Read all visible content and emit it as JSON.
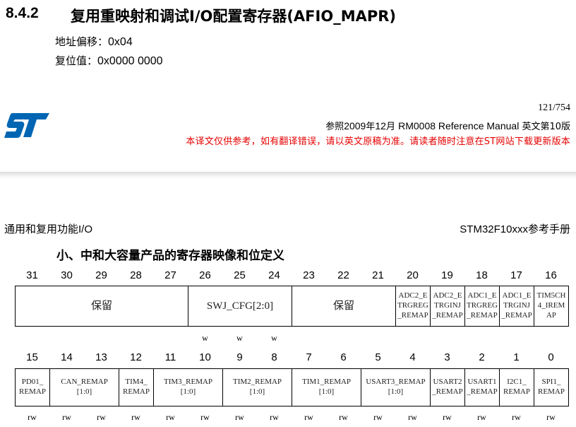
{
  "header": {
    "section_number": "8.4.2",
    "section_title": "复用重映射和调试I/O配置寄存器(AFIO_MAPR)",
    "offset_label": "地址偏移：",
    "offset_value": "0x04",
    "reset_label": "复位值：",
    "reset_value": "0x0000 0000"
  },
  "footer": {
    "logo": "st-logo-icon",
    "page_number": "121/754",
    "ref_prefix": "参照",
    "ref_year": "2009",
    "ref_year_unit": "年",
    "ref_month": "12",
    "ref_month_unit": "月 ",
    "ref_doc": "RM0008 Reference Manual",
    "ref_suffix": " 英文第10版",
    "notice": "本译文仅供参考，如有翻译错误，请以英文原稿为准。请读者随时注意在ST网站下载更新版本",
    "notice_color": "#e60000"
  },
  "page2": {
    "chapter_prefix": "通用和复用功能",
    "chapter_suffix": "I/O",
    "manual_latin": "STM32F10xxx",
    "manual_suffix": "参考手册",
    "table_caption": "小、中和大容量产品的寄存器映像和位定义"
  },
  "register": {
    "upper_bits": [
      "31",
      "30",
      "29",
      "28",
      "27",
      "26",
      "25",
      "24",
      "23",
      "22",
      "21",
      "20",
      "19",
      "18",
      "17",
      "16"
    ],
    "lower_bits": [
      "15",
      "14",
      "13",
      "12",
      "11",
      "10",
      "9",
      "8",
      "7",
      "6",
      "5",
      "4",
      "3",
      "2",
      "1",
      "0"
    ],
    "upper_fields": [
      {
        "line1": "保留",
        "line2": "",
        "line3": ""
      },
      {
        "line1": "SWJ_CFG[2:0]",
        "line2": "",
        "line3": ""
      },
      {
        "line1": "保留",
        "line2": "",
        "line3": ""
      },
      {
        "line1": "ADC2_E",
        "line2": "TRGREG",
        "line3": "_REMAP"
      },
      {
        "line1": "ADC2_E",
        "line2": "TRGINJ",
        "line3": "_REMAP"
      },
      {
        "line1": "ADC1_E",
        "line2": "TRGREG",
        "line3": "_REMAP"
      },
      {
        "line1": "ADC1_E",
        "line2": "TRGINJ",
        "line3": "_REMAP"
      },
      {
        "line1": "TIM5CH",
        "line2": "4_IREM",
        "line3": "AP"
      }
    ],
    "lower_fields": [
      {
        "line1": "PD01_",
        "line2": "REMAP"
      },
      {
        "line1": "CAN_REMAP",
        "line2": "[1:0]"
      },
      {
        "line1": "TIM4_",
        "line2": "REMAP"
      },
      {
        "line1": "TIM3_REMAP",
        "line2": "[1:0]"
      },
      {
        "line1": "TIM2_REMAP",
        "line2": "[1:0]"
      },
      {
        "line1": "TIM1_REMAP",
        "line2": "[1:0]"
      },
      {
        "line1": "USART3_REMAP",
        "line2": "[1:0]"
      },
      {
        "line1": "USART2",
        "line2": "_REMAP"
      },
      {
        "line1": "USART1",
        "line2": "_REMAP"
      },
      {
        "line1": "I2C1_",
        "line2": "REMAP"
      },
      {
        "line1": "SPI1_",
        "line2": "REMAP"
      }
    ],
    "upper_access": [
      "w",
      "w",
      "w"
    ],
    "lower_access": [
      "rw",
      "rw",
      "rw",
      "rw",
      "rw",
      "rw",
      "rw",
      "rw",
      "rw",
      "rw",
      "rw",
      "rw",
      "rw",
      "rw",
      "rw",
      "rw"
    ]
  }
}
